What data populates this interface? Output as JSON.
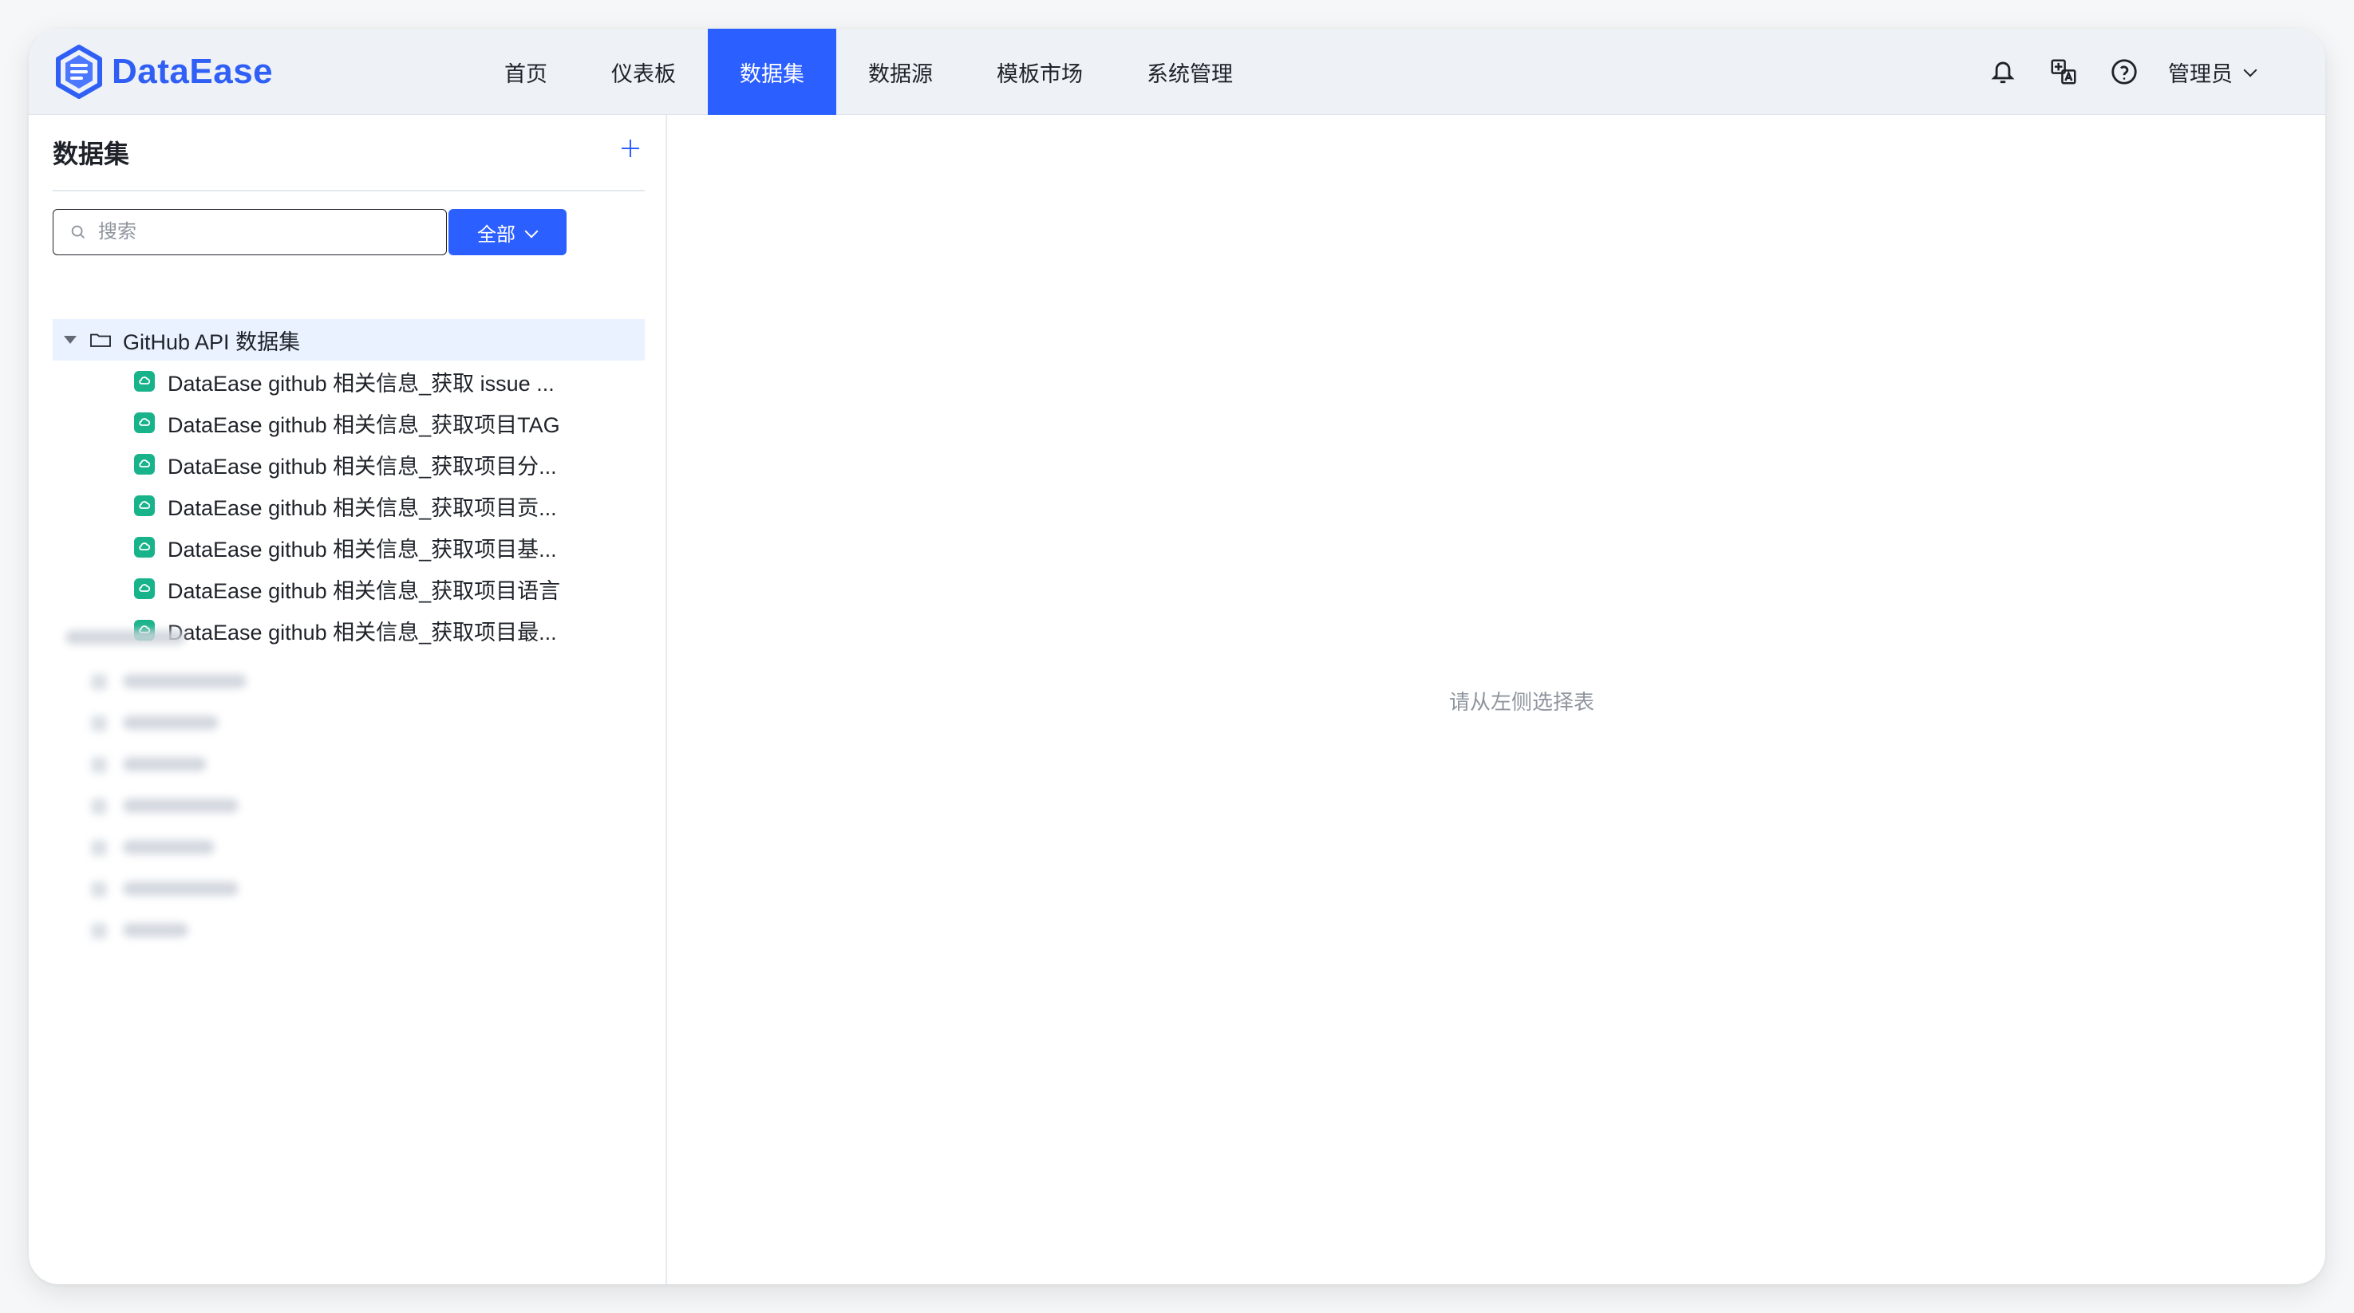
{
  "header": {
    "brand_name": "DataEase",
    "nav": [
      {
        "label": "首页"
      },
      {
        "label": "仪表板"
      },
      {
        "label": "数据集",
        "active": true
      },
      {
        "label": "数据源"
      },
      {
        "label": "模板市场"
      },
      {
        "label": "系统管理"
      }
    ],
    "user_label": "管理员",
    "icons": [
      "bell-icon",
      "translate-icon",
      "help-icon"
    ]
  },
  "sidebar": {
    "title": "数据集",
    "search": {
      "placeholder": "搜索",
      "value": ""
    },
    "filter_label": "全部",
    "folders": [
      {
        "label": "GitHub API 数据集",
        "expanded": true,
        "items": [
          {
            "label": "DataEase github 相关信息_获取 issue ..."
          },
          {
            "label": "DataEase github 相关信息_获取项目TAG"
          },
          {
            "label": "DataEase github 相关信息_获取项目分..."
          },
          {
            "label": "DataEase github 相关信息_获取项目贡..."
          },
          {
            "label": "DataEase github 相关信息_获取项目基..."
          },
          {
            "label": "DataEase github 相关信息_获取项目语言"
          },
          {
            "label": "DataEase github 相关信息_获取项目最..."
          }
        ]
      }
    ]
  },
  "main": {
    "empty_state": "请从左侧选择表"
  },
  "colors": {
    "accent": "#2c5fff",
    "header_bg": "#eef1f6",
    "dataset_icon": "#18b38a",
    "selected_row": "#eaf1ff",
    "muted_text": "#8f959e"
  }
}
